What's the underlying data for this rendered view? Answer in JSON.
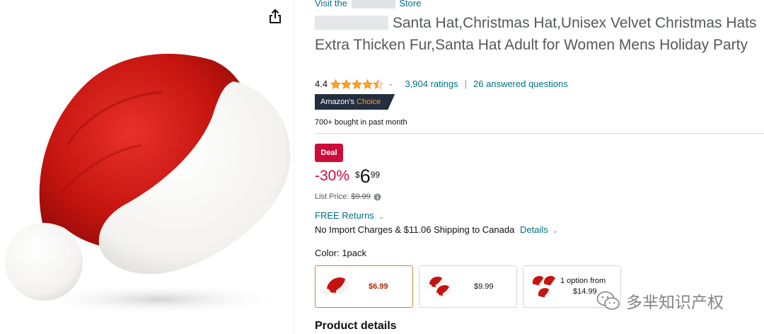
{
  "store": {
    "prefix": "Visit the ",
    "suffix": " Store"
  },
  "product": {
    "title_text": "Santa Hat,Christmas Hat,Unisex Velvet Christmas Hats Extra Thicken Fur,Santa Hat Adult for Women Mens Holiday Party"
  },
  "rating": {
    "value": "4.4",
    "stars_filled": 4.4,
    "count_label": "3,904 ratings",
    "separator": "|",
    "questions_label": "26 answered questions"
  },
  "badge": {
    "amazons": "Amazon's",
    "choice": "Choice"
  },
  "bought": "700+ bought in past month",
  "deal": {
    "label": "Deal",
    "discount": "-30%",
    "currency": "$",
    "whole": "6",
    "fraction": "99"
  },
  "list_price": {
    "label": "List Price:",
    "value": "$9.99"
  },
  "returns": {
    "label": "FREE Returns"
  },
  "shipping": {
    "text": "No Import Charges & $11.06 Shipping to Canada",
    "details": "Details"
  },
  "color": {
    "label": "Color:",
    "value": "1pack"
  },
  "swatches": [
    {
      "price": "$6.99",
      "selected": true
    },
    {
      "price": "$9.99",
      "selected": false
    },
    {
      "option_line1": "1 option from",
      "option_line2": "$14.99",
      "selected": false
    }
  ],
  "section": {
    "title": "Product details"
  },
  "watermark": {
    "text": "多芈知识产权"
  },
  "colors": {
    "link": "#007185",
    "deal_red": "#cc0c39",
    "star": "#ffa41c",
    "badge_dark": "#232f3e",
    "badge_orange": "#f69931"
  },
  "icons": [
    "share-icon",
    "star-icon",
    "chevron-down-icon",
    "info-icon",
    "wechat-icon"
  ]
}
